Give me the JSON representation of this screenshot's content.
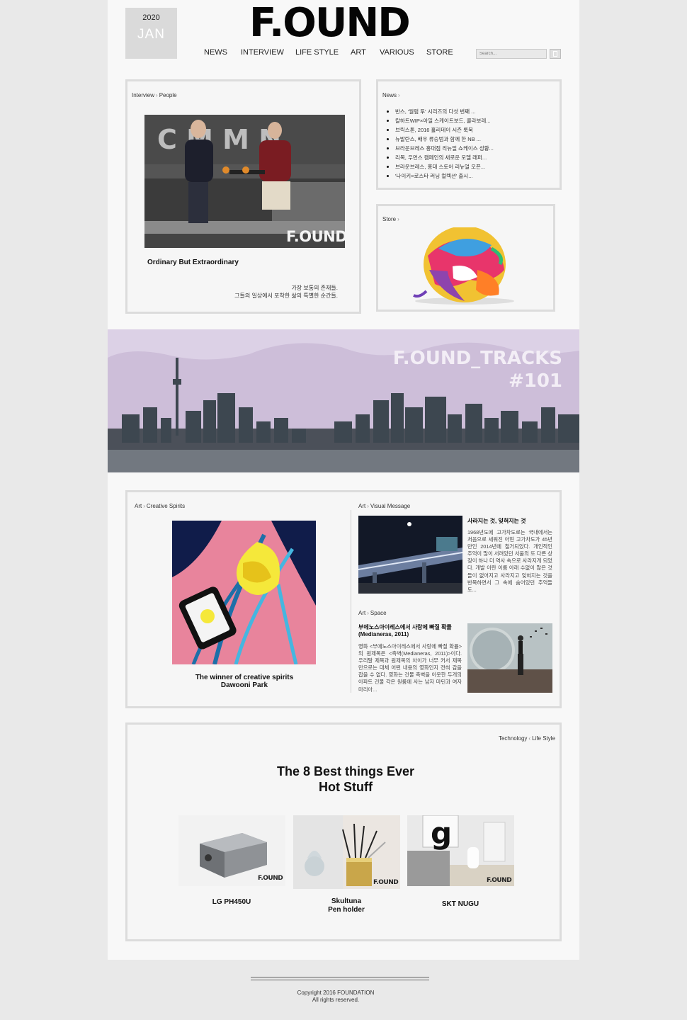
{
  "header": {
    "year": "2020",
    "month": "JAN",
    "logo": "F.OUND",
    "nav": [
      "NEWS",
      "INTERVIEW",
      "LIFE STYLE",
      "ART",
      "VARIOUS",
      "STORE"
    ],
    "search_placeholder": "Search..."
  },
  "interview": {
    "crumb_a": "Interview",
    "crumb_b": "People",
    "photo_sign": "C   M M   N",
    "watermark": "F.OUND",
    "title": "Ordinary But Extraordinary",
    "desc_1": "가장 보통의 존재들.",
    "desc_2": "그들의 일상에서 포착한 삶의 특별한 순간들."
  },
  "news": {
    "crumb": "News",
    "items": [
      "반스, '월럼 투' 시리즈의 다섯 번째 ...",
      "칼하트WIP×아일 스케이트보드, 콜라보레...",
      "브릭스톤, 2016 홀리데이 시즌 룩북",
      "뉴발란스, 배우 류승범과 함께 한 NB ...",
      "브라운브레스 홍대점 리뉴얼 쇼케이스 성황...",
      "리복, 우먼스 캠페인의 새로운 모델 래퍼...",
      "브라운브레스, 홍대 스토어 리뉴얼 오픈...",
      "'나이키×로스타 러닝 컬렉션' 출시..."
    ]
  },
  "store": {
    "crumb": "Store"
  },
  "banner": {
    "line1": "F.OUND_TRACKS",
    "line2": "#101"
  },
  "art": {
    "crumb_a": "Art",
    "crumb_b": "Creative Spirits",
    "caption_1": "The winner of creative spirits",
    "caption_2": "Dawooni Park"
  },
  "visual": {
    "crumb_a": "Art",
    "crumb_b": "Visual Message",
    "title": "사라지는 것, 잊혀지는 것",
    "text": "1968년도에 고가차도로는 국내에서는 처음으로 세워진 아현 고가차도가 45년만인 2014년에 철거되었다. 개인적인 추억이 많이 서려있던 서울의 또 다른 상징이 하나 더 역사 속으로 사라지게 되었다. 개발 이란 이름 아래 수없이 많은 것들이 없어지고 사라지고 잊혀지는 것을 반복하면서 그 속에 숨어있던 추억들도..."
  },
  "space": {
    "crumb_a": "Art",
    "crumb_b": "Space",
    "title_1": "부에노스아이레스에서 사랑에 빠질 확률",
    "title_2": "(Medianeras, 2011)",
    "text": "영화 <부에노스아이레스에서 사랑에 빠질 확률>의 원제목은 <측벽(Medianeras, 2011)>이다. 우리말 제목과 원제목의 차이가 너무 커서 제목만으로는 대체 어떤 내용의 영화인지 전혀 감을 잡을 수 없다. 영화는 건물 측벽을 이웃한 두개의 아파트 건물 각은 원룸에 사는 남자 마틴과 여자 마리아..."
  },
  "hot": {
    "crumb_a": "Technology",
    "crumb_b": "Life Style",
    "title_1": "The 8 Best things Ever",
    "title_2": "Hot Stuff",
    "watermark": "F.OUND",
    "products": [
      {
        "name": "LG PH450U"
      },
      {
        "name_1": "Skultuna",
        "name_2": "Pen holder"
      },
      {
        "name": "SKT NUGU"
      }
    ]
  },
  "footer": {
    "line1": "Copyright 2016 FOUNDATION",
    "line2": "All rights reserved."
  }
}
